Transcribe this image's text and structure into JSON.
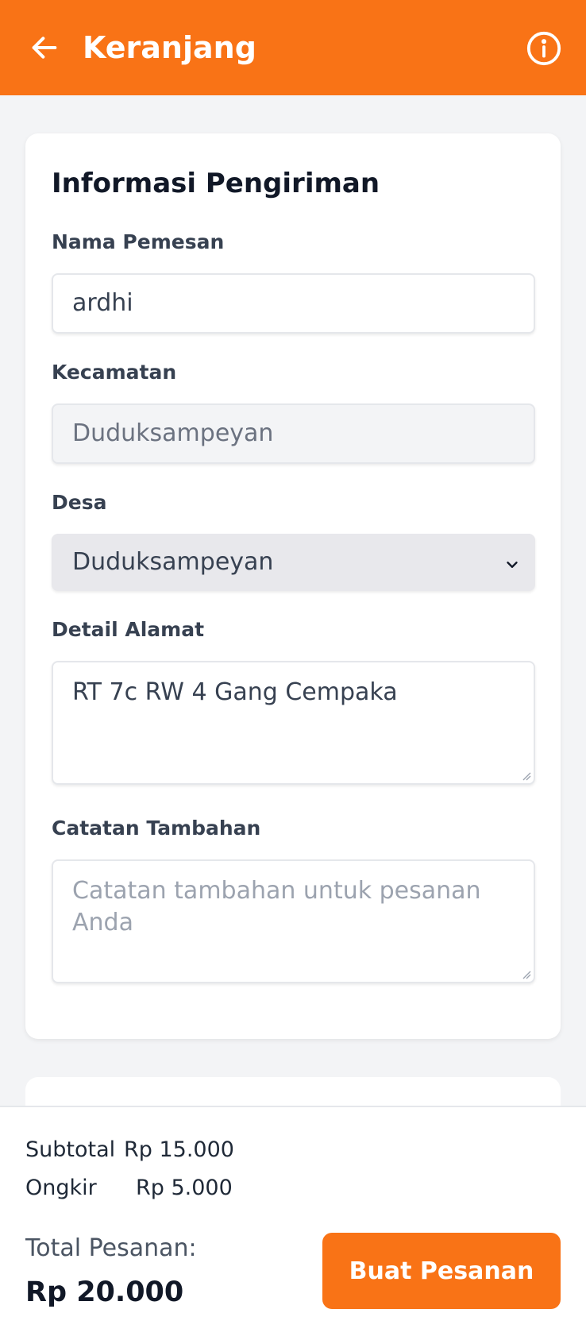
{
  "header": {
    "title": "Keranjang",
    "back_icon": "arrow-left-icon",
    "info_icon": "info-icon",
    "color": "#f97316"
  },
  "shipping": {
    "title": "Informasi Pengiriman",
    "name_label": "Nama Pemesan",
    "name_value": "ardhi",
    "district_label": "Kecamatan",
    "district_value": "Duduksampeyan",
    "village_label": "Desa",
    "village_value": "Duduksampeyan",
    "address_label": "Detail Alamat",
    "address_value": "RT 7c RW 4 Gang Cempaka",
    "notes_label": "Catatan Tambahan",
    "notes_placeholder": "Catatan tambahan untuk pesanan Anda",
    "notes_value": ""
  },
  "summary": {
    "subtotal_label": "Subtotal",
    "subtotal_value": "Rp 15.000",
    "shipping_label": "Ongkir",
    "shipping_value": "Rp 5.000",
    "total_label": "Total Pesanan:",
    "total_value": "Rp 20.000",
    "order_button": "Buat Pesanan"
  }
}
